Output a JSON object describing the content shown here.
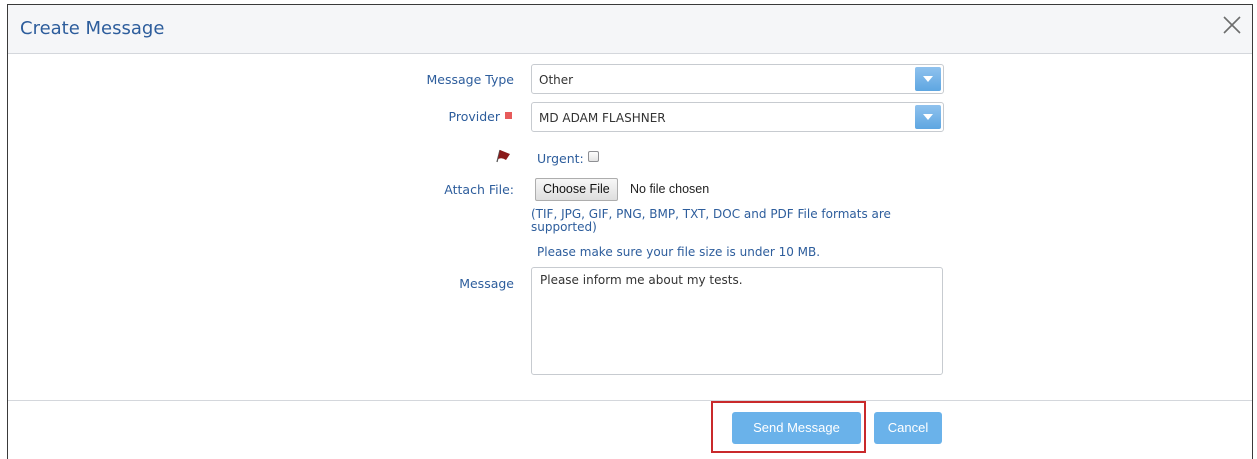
{
  "dialog": {
    "title": "Create Message"
  },
  "form": {
    "message_type": {
      "label": "Message Type",
      "value": "Other"
    },
    "provider": {
      "label": "Provider",
      "value": "MD ADAM FLASHNER",
      "required_color": "#e75b5b"
    },
    "urgent": {
      "label": "Urgent:",
      "checked": false
    },
    "attach": {
      "label": "Attach File:",
      "button": "Choose File",
      "status": "No file chosen",
      "formats_hint": "(TIF, JPG, GIF, PNG, BMP, TXT, DOC and PDF File formats are supported)",
      "size_hint": "Please make sure your file size is under 10 MB."
    },
    "message": {
      "label": "Message",
      "value": "Please inform me about my tests."
    }
  },
  "footer": {
    "send_label": "Send Message",
    "cancel_label": "Cancel"
  },
  "colors": {
    "accent": "#2d5d9c",
    "button": "#6ab2ea",
    "highlight": "#c9292b",
    "flag": "#8b1a1a"
  },
  "icons": {
    "close": "close-icon",
    "dropdown": "chevron-down-icon",
    "flag": "flag-icon"
  }
}
